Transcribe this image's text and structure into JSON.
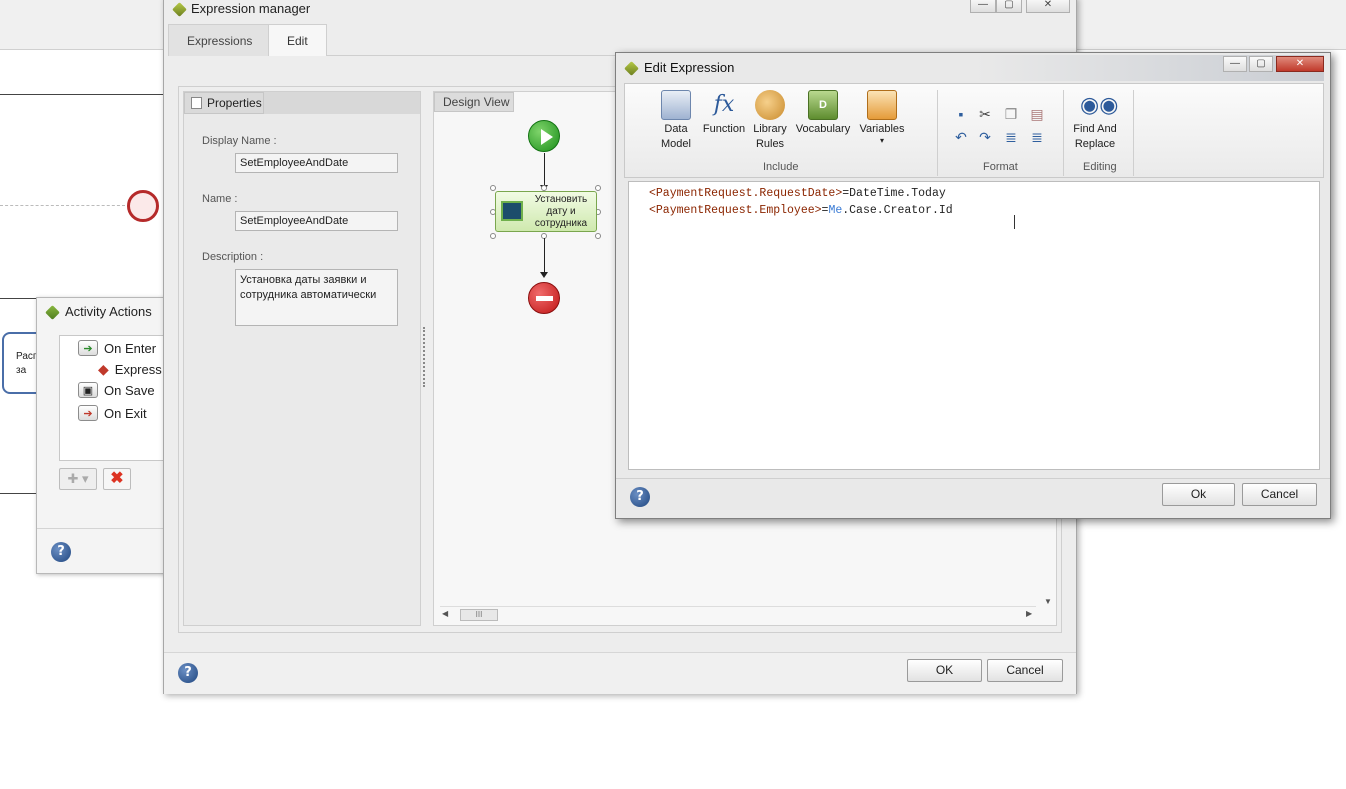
{
  "background": {
    "task_label_1": "Расг",
    "task_label_2": "за"
  },
  "activity_actions": {
    "title": "Activity Actions",
    "tree": [
      {
        "label": "On Enter",
        "icon": "enter-icon"
      },
      {
        "label": "Express",
        "icon": "expression-icon"
      },
      {
        "label": "On Save",
        "icon": "save-icon"
      },
      {
        "label": "On Exit",
        "icon": "exit-icon"
      }
    ],
    "help": "?"
  },
  "expression_manager": {
    "title": "Expression manager",
    "tabs": [
      {
        "label": "Expressions",
        "active": false
      },
      {
        "label": "Edit",
        "active": true
      }
    ],
    "properties": {
      "header": "Properties",
      "display_name_label": "Display Name :",
      "display_name_value": "SetEmployeeAndDate",
      "name_label": "Name :",
      "name_value": "SetEmployeeAndDate",
      "description_label": "Description :",
      "description_value": "Установка даты заявки и сотрудника автоматически"
    },
    "design_view": {
      "header": "Design View",
      "action_node_label": "Установить дату и сотрудника",
      "scroll_thumb": "III"
    },
    "footer": {
      "ok_label": "OK",
      "cancel_label": "Cancel",
      "help": "?"
    }
  },
  "edit_expression": {
    "title": "Edit Expression",
    "ribbon": {
      "include": {
        "label": "Include",
        "buttons": [
          {
            "label_1": "Data",
            "label_2": "Model",
            "icon": "data-model-icon"
          },
          {
            "label_1": "Function",
            "label_2": "",
            "icon": "function-icon"
          },
          {
            "label_1": "Library",
            "label_2": "Rules",
            "icon": "library-rules-icon"
          },
          {
            "label_1": "Vocabulary",
            "label_2": "",
            "icon": "vocabulary-icon"
          },
          {
            "label_1": "Variables",
            "label_2": "▾",
            "icon": "variables-icon"
          }
        ]
      },
      "format": {
        "label": "Format"
      },
      "editing": {
        "label": "Editing",
        "find_replace_1": "Find And",
        "find_replace_2": "Replace"
      }
    },
    "code_lines": [
      {
        "tag": "<PaymentRequest.RequestDate>",
        "op": "=",
        "rest": "DateTime.Today",
        "kw": ""
      },
      {
        "tag": "<PaymentRequest.Employee>",
        "op": "=",
        "kw": "Me",
        "rest": ".Case.Creator.Id"
      }
    ],
    "footer": {
      "ok_label": "Ok",
      "cancel_label": "Cancel",
      "help": "?"
    },
    "colors": {
      "tag": "#8b2500",
      "keyword": "#3a7bd5"
    }
  }
}
